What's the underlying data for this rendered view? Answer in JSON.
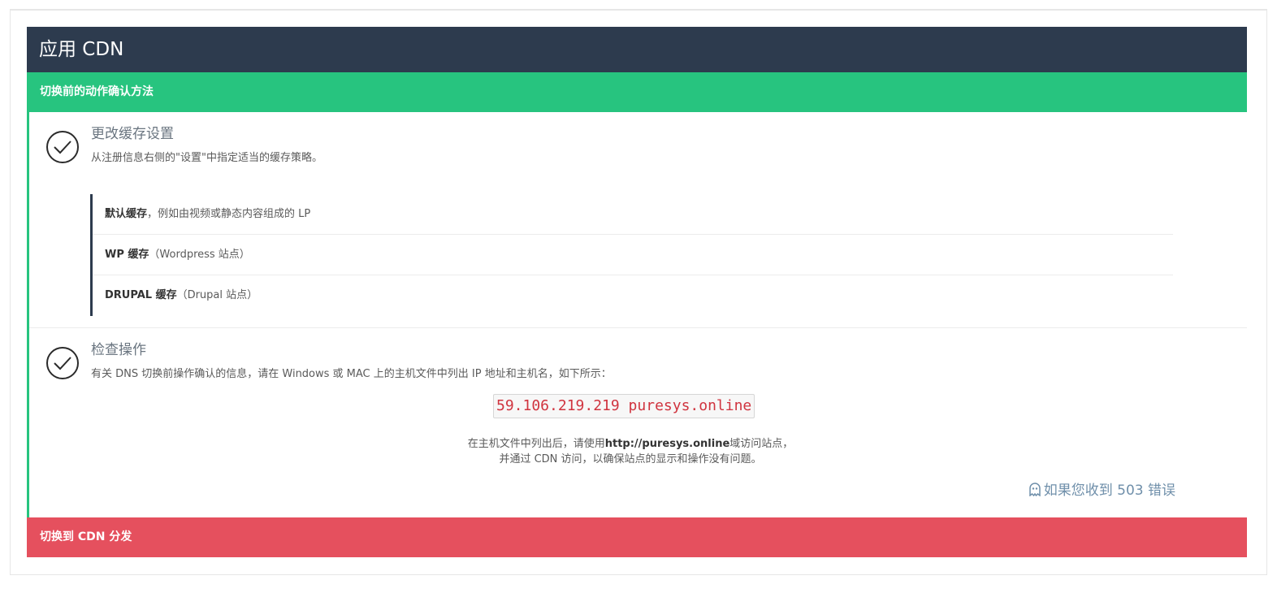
{
  "panel": {
    "title": "应用 CDN",
    "pre_switch_bar": "切换前的动作确认方法",
    "switch_bar": "切换到 CDN 分发"
  },
  "step1": {
    "icon": "check-circle-icon",
    "title": "更改缓存设置",
    "desc": "从注册信息右侧的\"设置\"中指定适当的缓存策略。",
    "items": [
      {
        "bold": "默认缓存",
        "rest": "，例如由视频或静态内容组成的 LP"
      },
      {
        "bold": "WP 缓存",
        "rest": "（Wordpress 站点）"
      },
      {
        "bold": "DRUPAL 缓存",
        "rest": "（Drupal 站点）"
      }
    ]
  },
  "step2": {
    "icon": "check-circle-icon",
    "title": "检查操作",
    "desc": "有关 DNS 切换前操作确认的信息，请在 Windows 或 MAC 上的主机文件中列出 IP 地址和主机名，如下所示：",
    "hosts_entry": "59.106.219.219 puresys.online",
    "note1_pre": "在主机文件中列出后，请使用",
    "note1_url": "http://puresys.online",
    "note1_post": "域访问站点，",
    "note2": "并通过 CDN 访问，以确保站点的显示和操作没有问题。",
    "error_link_icon": "ghost-icon",
    "error_link": "如果您收到 503 错误"
  },
  "colors": {
    "header_bg": "#2d3b4e",
    "green": "#27c47f",
    "red": "#e5505e",
    "code_text": "#d0343f"
  }
}
